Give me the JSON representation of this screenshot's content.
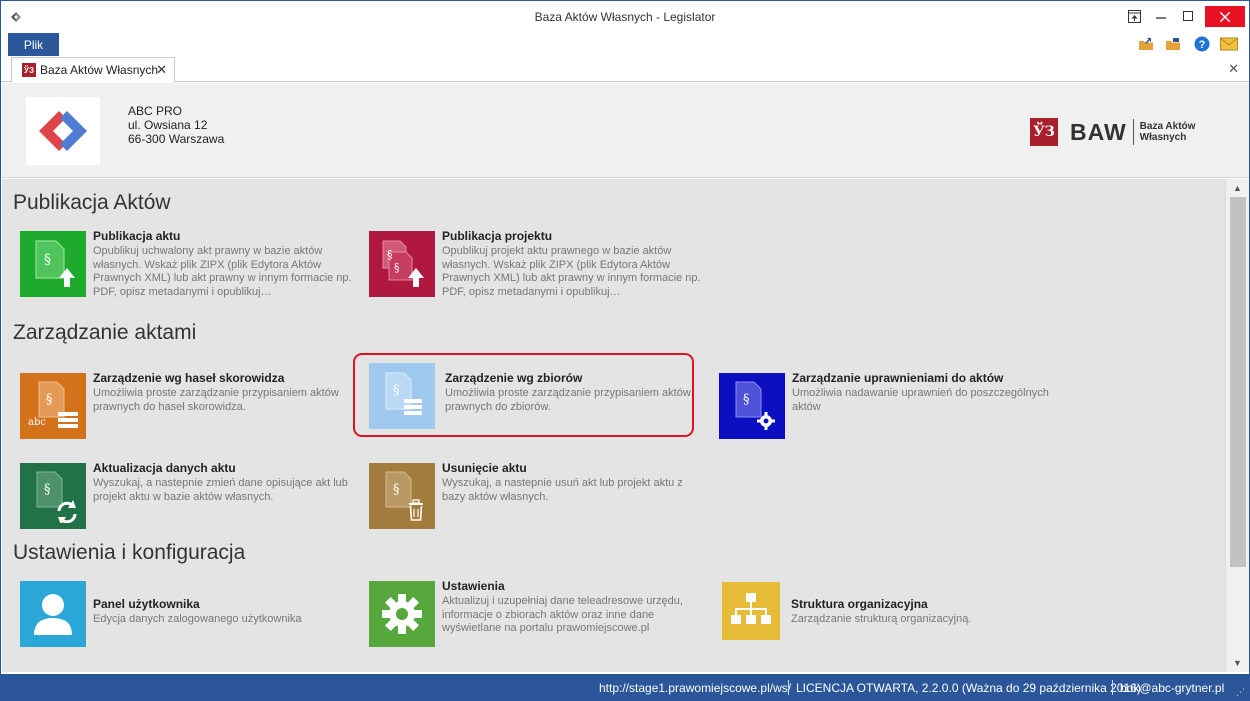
{
  "window": {
    "title": "Baza Aktów Własnych - Legislator"
  },
  "ribbon": {
    "file_label": "Plik"
  },
  "tab": {
    "label": "Baza Aktów Własnych",
    "badge": "ЎЗ"
  },
  "header": {
    "company": "ABC PRO",
    "street": "ul. Owsiana 12",
    "city": "66-300 Warszawa",
    "brand_badge": "ЎЗ",
    "brand_word": "BAW",
    "brand_sub_line1": "Baza Aktów",
    "brand_sub_line2": "Własnych"
  },
  "sections": {
    "publikacja": {
      "title": "Publikacja Aktów",
      "tiles": [
        {
          "title": "Publikacja aktu",
          "desc": "Opublikuj uchwalony akt prawny w bazie aktów własnych.  Wskaż plik ZIPX (plik Edytora Aktów Prawnych XML) lub akt prawny w innym formacie np. PDF, opisz metadanymi i opublikuj…",
          "color": "#1eaa2c"
        },
        {
          "title": "Publikacja projektu",
          "desc": "Opublikuj projekt aktu prawnego w bazie aktów własnych.  Wskaż plik ZIPX (plik Edytora Aktów Prawnych XML) lub akt prawny w innym formacie np. PDF, opisz metadanymi i opublikuj…",
          "color": "#b0183f"
        }
      ]
    },
    "zarzadzanie": {
      "title": "Zarządzanie aktami",
      "tiles": [
        {
          "title": "Zarządzenie wg haseł skorowidza",
          "desc": "Umożliwia proste zarządzanie przypisaniem aktów prawnych do haseł skorowidza.",
          "color": "#d2731c",
          "icon_text": "abc"
        },
        {
          "title": "Zarządzenie wg zbiorów",
          "desc": "Umożliwia proste zarządzanie przypisaniem aktów prawnych do zbiorów.",
          "color": "#9fc9ef"
        },
        {
          "title": "Zarządzanie uprawnieniami do aktów",
          "desc": "Umożliwia nadawanie uprawnień do poszczególnych aktów",
          "color": "#0b0fc0"
        },
        {
          "title": "Aktualizacja danych aktu",
          "desc": "Wyszukaj, a nastepnie zmień dane opisujące akt lub projekt aktu w bazie aktów własnych.",
          "color": "#217246"
        },
        {
          "title": "Usunięcie aktu",
          "desc": "Wyszukaj, a nastepnie usuń akt lub projekt aktu z bazy aktów własnych.",
          "color": "#a27c3c"
        }
      ]
    },
    "ustawienia": {
      "title": "Ustawienia i konfiguracja",
      "tiles": [
        {
          "title": "Panel użytkownika",
          "desc": "Edycja danych zalogowanego użytkownika",
          "color": "#2aa7d6"
        },
        {
          "title": "Ustawienia",
          "desc": "Aktualizuj i uzupełniaj dane teleadresowe urzędu, informacje o zbiorach aktów oraz inne dane wyświetlane na portalu prawomiejscowe.pl",
          "color": "#56a83c"
        },
        {
          "title": "Struktura organizacyjna",
          "desc": "Zarządzanie strukturą organizacyjną.",
          "color": "#e6bb38"
        }
      ]
    }
  },
  "status": {
    "url": "http://stage1.prawomiejscowe.pl/ws/",
    "license": "LICENCJA OTWARTA, 2.2.0.0 (Ważna do 29 października 2016)",
    "email": "bok@abc-grytner.pl"
  }
}
